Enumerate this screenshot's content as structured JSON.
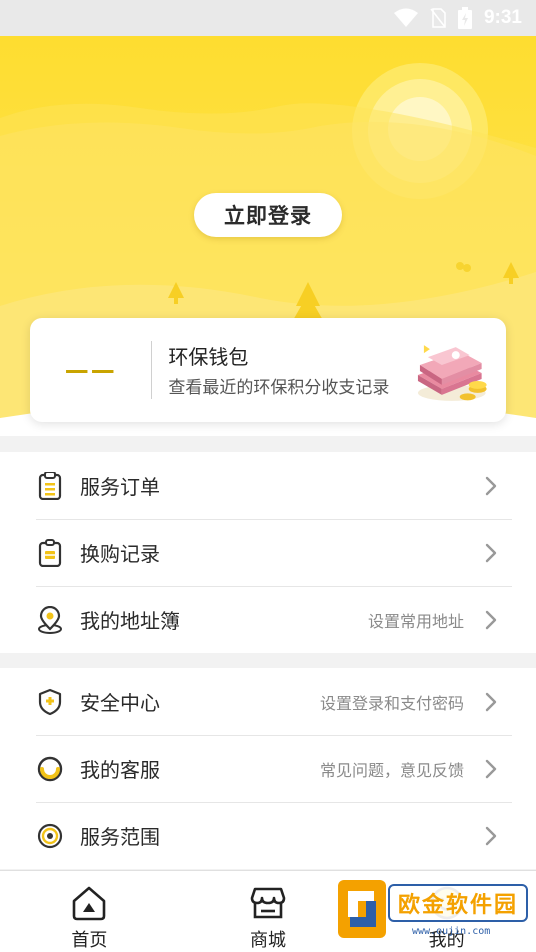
{
  "status_bar": {
    "time": "9:31"
  },
  "hero": {
    "login_label": "立即登录"
  },
  "wallet": {
    "amount": "——",
    "title": "环保钱包",
    "description": "查看最近的环保积分收支记录"
  },
  "menu_group_1": [
    {
      "label": "服务订单",
      "hint": "",
      "icon": "clipboard-icon"
    },
    {
      "label": "换购记录",
      "hint": "",
      "icon": "exchange-record-icon"
    },
    {
      "label": "我的地址簿",
      "hint": "设置常用地址",
      "icon": "location-pin-icon"
    }
  ],
  "menu_group_2": [
    {
      "label": "安全中心",
      "hint": "设置登录和支付密码",
      "icon": "shield-icon"
    },
    {
      "label": "我的客服",
      "hint": "常见问题，意见反馈",
      "icon": "customer-service-icon"
    },
    {
      "label": "服务范围",
      "hint": "",
      "icon": "range-icon"
    }
  ],
  "bottom_nav": [
    {
      "label": "首页",
      "icon": "home-icon",
      "active": false
    },
    {
      "label": "商城",
      "icon": "store-icon",
      "active": false
    },
    {
      "label": "我的",
      "icon": "smiley-icon",
      "active": true
    }
  ],
  "watermark": {
    "text": "欧金软件园",
    "url": "www.oujin.com"
  },
  "colors": {
    "accent": "#fedd30",
    "wallet_amount": "#c9a400"
  }
}
